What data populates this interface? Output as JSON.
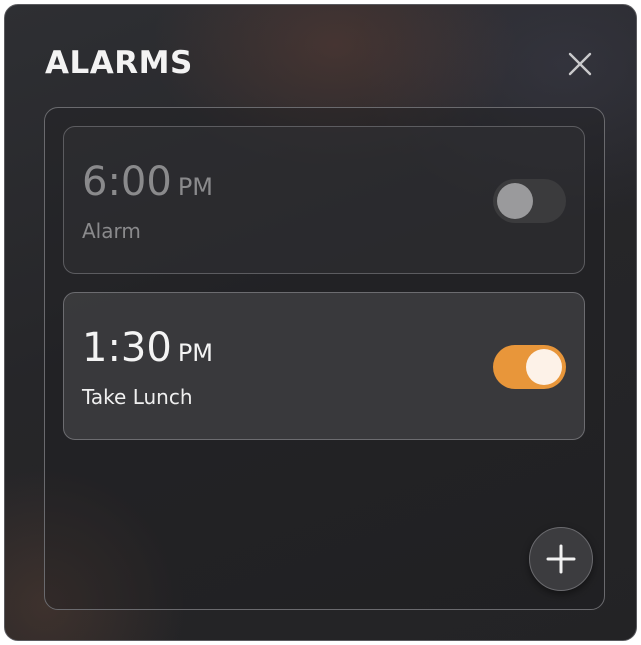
{
  "window": {
    "title": "ALARMS",
    "close_icon": "close-icon"
  },
  "alarms": [
    {
      "time": "6:00",
      "period": "PM",
      "label": "Alarm",
      "enabled": false
    },
    {
      "time": "1:30",
      "period": "PM",
      "label": "Take Lunch",
      "enabled": true
    }
  ],
  "add_button": {
    "icon": "plus-icon"
  },
  "colors": {
    "accent": "#e8963a",
    "knob_on": "#fdf2e8",
    "knob_off": "#9a9a9c",
    "track_off": "#3b3b3d",
    "text_primary": "#f4f4f4",
    "text_disabled": "#8a8a8c"
  }
}
